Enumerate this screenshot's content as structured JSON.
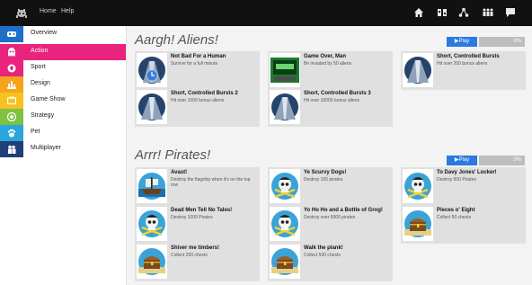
{
  "topbar": {
    "home_label": "Home",
    "help_label": "Help",
    "icons": [
      "house-icon",
      "controller-icon",
      "share-icon",
      "people-icon",
      "chat-icon"
    ]
  },
  "sidebar": {
    "items": [
      {
        "label": "Overview",
        "color": "#1f6fc9",
        "icon": "controller-icon"
      },
      {
        "label": "Action",
        "color": "#e8247c",
        "icon": "alien-icon"
      },
      {
        "label": "Sport",
        "color": "#e8247c",
        "icon": "ball-icon"
      },
      {
        "label": "Design",
        "color": "#f7a41d",
        "icon": "chart-icon"
      },
      {
        "label": "Game Show",
        "color": "#f7c21d",
        "icon": "tv-icon"
      },
      {
        "label": "Strategy",
        "color": "#7dc242",
        "icon": "target-icon"
      },
      {
        "label": "Pet",
        "color": "#2aa6de",
        "icon": "paw-icon"
      },
      {
        "label": "Multiplayer",
        "color": "#1f3f7a",
        "icon": "people-icon"
      }
    ]
  },
  "sections": [
    {
      "title": "Aargh! Aliens!",
      "play_label": "Play",
      "progress_pct": 0,
      "progress_label": "0%",
      "cards": [
        {
          "title": "Not Bad For a Human",
          "desc": "Survive for a full minute",
          "art": "clock"
        },
        {
          "title": "Game Over, Man",
          "desc": "Be invaded by 50 aliens",
          "art": "gameover"
        },
        {
          "title": "Short, Controlled Bursts",
          "desc": "Hit over 250 bonus aliens",
          "art": "tunnel"
        },
        {
          "title": "Short, Controlled Bursts 2",
          "desc": "Hit over 1000 bonus aliens",
          "art": "tunnel"
        },
        {
          "title": "Short, Controlled Bursts 3",
          "desc": "Hit over 10000 bonus aliens",
          "art": "tunnel"
        }
      ]
    },
    {
      "title": "Arrr! Pirates!",
      "play_label": "Play",
      "progress_pct": 0,
      "progress_label": "0%",
      "cards": [
        {
          "title": "Avast!",
          "desc": "Destroy the flagship when it's on the top row",
          "art": "ship"
        },
        {
          "title": "Ye Scurvy Dogs!",
          "desc": "Destroy 100 pirates",
          "art": "skull"
        },
        {
          "title": "To Davy Jones' Locker!",
          "desc": "Destroy 500 Pirates",
          "art": "skull"
        },
        {
          "title": "Dead Men Tell No Tales!",
          "desc": "Destroy 1000 Pirates",
          "art": "skull"
        },
        {
          "title": "Yo Ho Ho and a Bottle of Grog!",
          "desc": "Destroy over 5000 pirates",
          "art": "skull"
        },
        {
          "title": "Pieces o' Eight",
          "desc": "Collect 50 chests",
          "art": "chest"
        },
        {
          "title": "Shiver me timbers!",
          "desc": "Collect 250 chests",
          "art": "chest"
        },
        {
          "title": "Walk the plank!",
          "desc": "Collect 500 chests",
          "art": "chest"
        }
      ]
    }
  ]
}
